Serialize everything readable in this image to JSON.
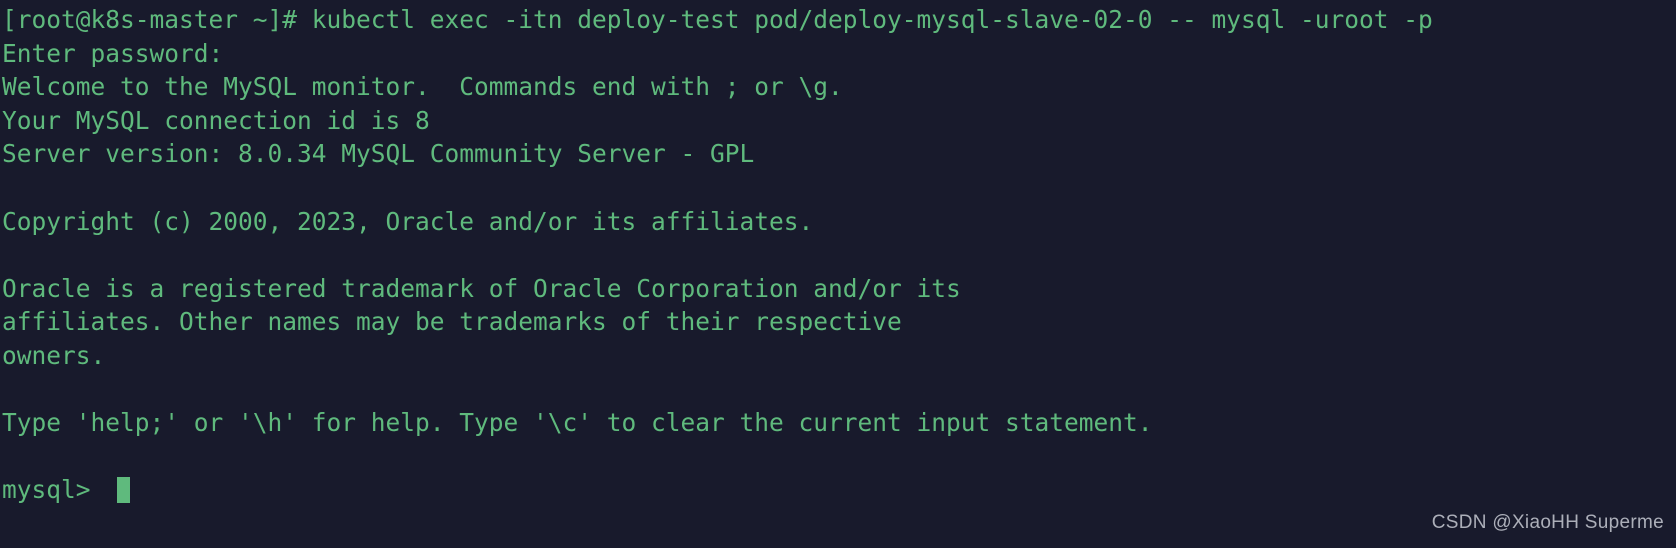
{
  "terminal": {
    "background_color": "#181a2c",
    "text_color": "#5fba7d",
    "cursor_color": "#5fba7d",
    "lines": [
      "[root@k8s-master ~]# kubectl exec -itn deploy-test pod/deploy-mysql-slave-02-0 -- mysql -uroot -p",
      "Enter password:",
      "Welcome to the MySQL monitor.  Commands end with ; or \\g.",
      "Your MySQL connection id is 8",
      "Server version: 8.0.34 MySQL Community Server - GPL",
      "",
      "Copyright (c) 2000, 2023, Oracle and/or its affiliates.",
      "",
      "Oracle is a registered trademark of Oracle Corporation and/or its",
      "affiliates. Other names may be trademarks of their respective",
      "owners.",
      "",
      "Type 'help;' or '\\h' for help. Type '\\c' to clear the current input statement.",
      ""
    ],
    "prompt": "mysql> ",
    "cursor": "block-cursor"
  },
  "watermark": {
    "text": "CSDN @XiaoHH Superme",
    "color": "#b9bcc6"
  }
}
